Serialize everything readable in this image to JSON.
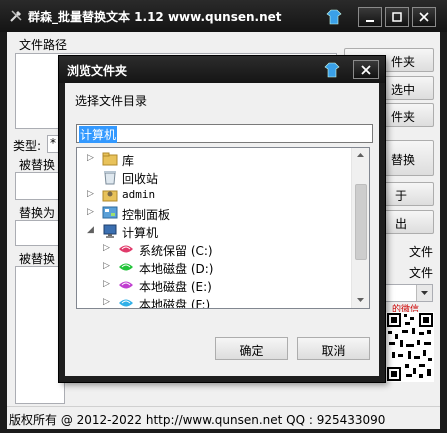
{
  "main": {
    "title": "群森_批量替换文本  1.12    www.qunsen.net",
    "labels": {
      "path": "文件路径",
      "type": "类型:",
      "type_value": "*",
      "find": "被替换",
      "replace": "替换为",
      "files": "被替换"
    },
    "right_buttons": [
      "件夹",
      "选中",
      "件夹",
      "替换",
      "于",
      "出"
    ],
    "right_labels": [
      "文件",
      "文件"
    ],
    "wechat_hint": "的微信",
    "status": "版权所有 @ 2012-2022  http://www.qunsen.net  QQ : 925433090"
  },
  "dialog": {
    "title": "浏览文件夹",
    "instruction": "选择文件目录",
    "selected_path": "计算机",
    "tree": [
      {
        "label": "库",
        "icon": "library-icon"
      },
      {
        "label": "回收站",
        "icon": "recycle-bin-icon"
      },
      {
        "label": "admin",
        "icon": "user-folder-icon"
      },
      {
        "label": "控制面板",
        "icon": "control-panel-icon"
      },
      {
        "label": "计算机",
        "icon": "computer-icon"
      },
      {
        "label": "系统保留 (C:)",
        "icon": "drive-icon"
      },
      {
        "label": "本地磁盘 (D:)",
        "icon": "drive-icon"
      },
      {
        "label": "本地磁盘 (E:)",
        "icon": "drive-icon"
      },
      {
        "label": "本地磁盘 (F:)",
        "icon": "drive-icon"
      }
    ],
    "ok_label": "确定",
    "cancel_label": "取消"
  },
  "colors": {
    "titlebar": "#1b1b1b",
    "client": "#f0f0f0",
    "selection": "#3399ff"
  }
}
